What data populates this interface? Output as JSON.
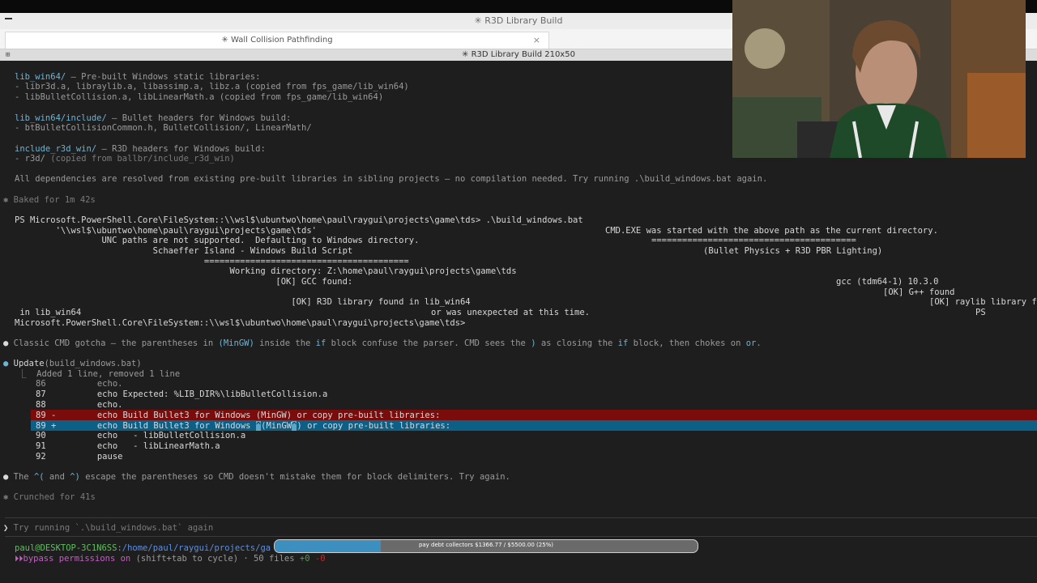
{
  "window": {
    "title": "✳ R3D Library Build"
  },
  "tab": {
    "label": "✳ Wall Collision Pathfinding",
    "close": "×"
  },
  "terminal_header": {
    "title": "✳ R3D Library Build 210x50",
    "icon": "⊞"
  },
  "lines": {
    "l1_name": "lib_win64/",
    "l1_desc": " — Pre-built Windows static libraries:",
    "l2": "- libr3d.a, libraylib.a, libassimp.a, libz.a (copied from fps_game/lib_win64)",
    "l3": "- libBulletCollision.a, libLinearMath.a (copied from fps_game/lib_win64)",
    "l4_name": "lib_win64/include/",
    "l4_desc": " — Bullet headers for Windows build:",
    "l5": "- btBulletCollisionCommon.h, BulletCollision/, LinearMath/",
    "l6_name": "include_r3d_win/",
    "l6_desc": " — R3D headers for Windows build:",
    "l7a": "- r3d/",
    "l7b": " (copied from ballbr/include_r3d_win)",
    "l8": "All dependencies are resolved from existing pre-built libraries in sibling projects — no compilation needed. Try running .\\build_windows.bat again.",
    "baked": "✱ Baked for 1m 42s",
    "ps1": "PS Microsoft.PowerShell.Core\\FileSystem::\\\\wsl$\\ubuntwo\\home\\paul\\raygui\\projects\\game\\tds> .\\build_windows.bat",
    "ps2": "        '\\\\wsl$\\ubuntwo\\home\\paul\\raygui\\projects\\game\\tds'",
    "ps2r": "CMD.EXE was started with the above path as the current directory.",
    "ps3": "                 UNC paths are not supported.  Defaulting to Windows directory.",
    "ps3r": "========================================",
    "ps4": "                           Schaeffer Island - Windows Build Script",
    "ps4r": "(Bullet Physics + R3D PBR Lighting)",
    "ps5": "                                     ========================================",
    "ps6": "                                          Working directory: Z:\\home\\paul\\raygui\\projects\\game\\tds",
    "ps7": "                                                   [OK] GCC found:",
    "ps7r": "gcc (tdm64-1) 10.3.0",
    "ps8r": "[OK] G++ found",
    "ps9": "                                                      [OK] R3D library found in lib_win64",
    "ps9r": "[OK] raylib library f",
    "ps10": " in lib_win64",
    "ps10m": "or was unexpected at this time.",
    "ps10r": "PS",
    "ps11": "Microsoft.PowerShell.Core\\FileSystem::\\\\wsl$\\ubuntwo\\home\\paul\\raygui\\projects\\game\\tds>",
    "gotcha_pre": "Classic CMD gotcha — the parentheses in ",
    "gotcha_m1": "(MinGW)",
    "gotcha_mid": " inside the ",
    "gotcha_if1": "if",
    "gotcha_mid2": " block confuse the parser. CMD sees the ",
    "gotcha_paren": ")",
    "gotcha_mid3": " as closing the ",
    "gotcha_if2": "if",
    "gotcha_mid4": " block, then chokes on ",
    "gotcha_or": "or",
    "gotcha_end": ".",
    "update_bullet": "●",
    "update_label": "Update",
    "update_file": "(build_windows.bat)",
    "added": "⎿  Added 1 line, removed 1 line",
    "d86": "86          echo.",
    "d87": "87          echo Expected: %LIB_DIR%\\libBulletCollision.a",
    "d88": "88          echo.",
    "d89m": "89 -        echo Build Bullet3 for Windows (MinGW) or copy pre-built libraries:",
    "d89p_a": "89 +        echo Build Bullet3 for Windows ",
    "d89p_hl1": "^",
    "d89p_b": "(MinGW",
    "d89p_hl2": "^",
    "d89p_c": ") or copy pre-built libraries:",
    "d90": "90          echo   - libBulletCollision.a",
    "d91": "91          echo   - libLinearMath.a",
    "d92": "92          pause",
    "escape_pre": "The ",
    "escape_c1": "^(",
    "escape_and": " and ",
    "escape_c2": "^)",
    "escape_end": " escape the parentheses so CMD doesn't mistake them for block delimiters. Try again.",
    "crunched": "✱ Crunched for 41s"
  },
  "prompt": {
    "symbol": "❯",
    "placeholder": "Try running `.\\build_windows.bat` again"
  },
  "status": {
    "user": "paul@DESKTOP-3C1N6SS",
    "path": ":/home/paul/raygui/projects/ga",
    "perm_icon": "⏵⏵",
    "perm_text": "bypass permissions on",
    "perm_hint": " (shift+tab to cycle) · 50 files ",
    "plus": "+0",
    "minus": " -0"
  },
  "progress": {
    "label": "pay debt collectors $1366.77 / $5500.00 (25%)",
    "fraction": 0.25
  },
  "colors": {
    "accent_blue": "#6fb3d2",
    "removed_bg": "#7a0c0c",
    "added_bg": "#0e5f86",
    "progress_fill": "#3d8fc0"
  }
}
